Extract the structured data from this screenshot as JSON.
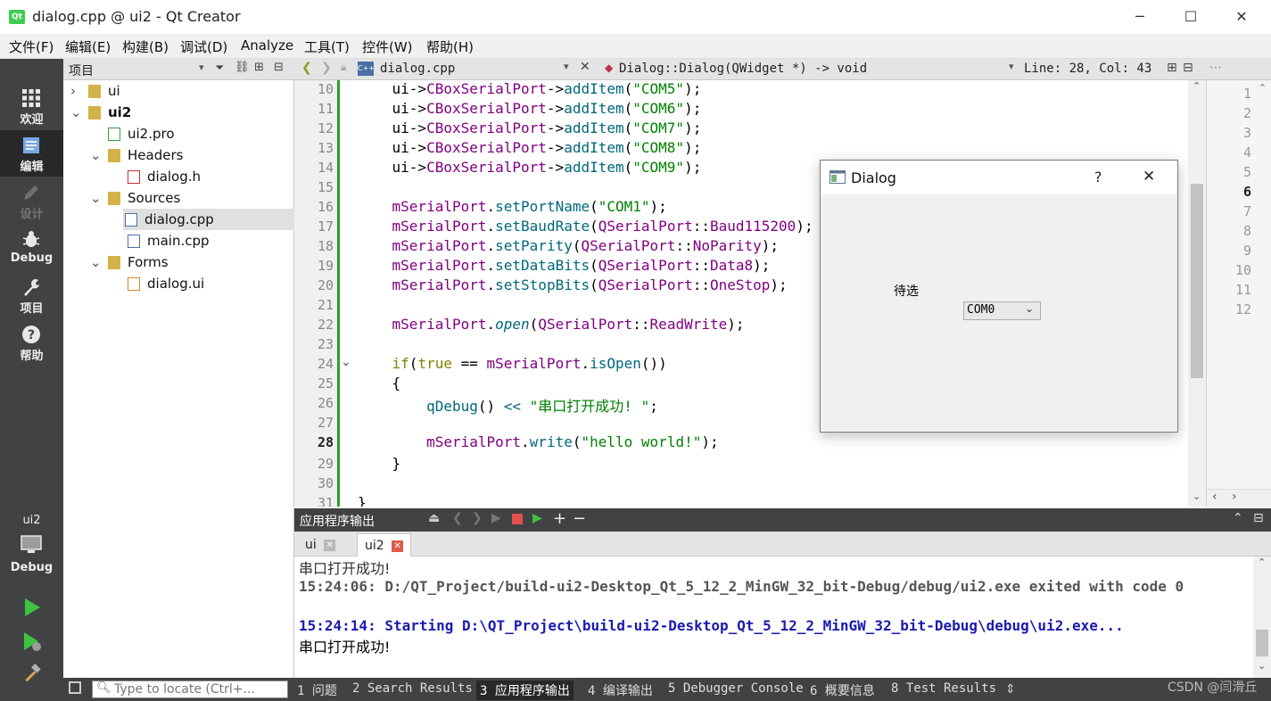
{
  "window": {
    "title": "dialog.cpp @ ui2 - Qt Creator",
    "logo": "Qt",
    "controls": [
      "─",
      "☐",
      "✕"
    ]
  },
  "menubar": [
    "文件(F)",
    "编辑(E)",
    "构建(B)",
    "调试(D)",
    "Analyze",
    "工具(T)",
    "控件(W)",
    "帮助(H)"
  ],
  "modes": [
    {
      "label": "欢迎",
      "icon": "grid-icon"
    },
    {
      "label": "编辑",
      "icon": "document-icon"
    },
    {
      "label": "设计",
      "icon": "pencil-icon"
    },
    {
      "label": "Debug",
      "icon": "bug-icon"
    },
    {
      "label": "项目",
      "icon": "wrench-icon"
    },
    {
      "label": "帮助",
      "icon": "help-icon"
    }
  ],
  "kit": {
    "project": "ui2",
    "mode": "Debug"
  },
  "project_panel": {
    "title": "项目",
    "tree": [
      {
        "label": "ui",
        "level": 0,
        "arrow": ">",
        "type": "project"
      },
      {
        "label": "ui2",
        "level": 0,
        "arrow": "v",
        "type": "project",
        "bold": true
      },
      {
        "label": "ui2.pro",
        "level": 1,
        "arrow": "",
        "type": "pro"
      },
      {
        "label": "Headers",
        "level": 1,
        "arrow": "v",
        "type": "folder-h"
      },
      {
        "label": "dialog.h",
        "level": 2,
        "arrow": "",
        "type": "header"
      },
      {
        "label": "Sources",
        "level": 1,
        "arrow": "v",
        "type": "folder-c"
      },
      {
        "label": "dialog.cpp",
        "level": 2,
        "arrow": "",
        "type": "cpp",
        "selected": true
      },
      {
        "label": "main.cpp",
        "level": 2,
        "arrow": "",
        "type": "cpp"
      },
      {
        "label": "Forms",
        "level": 1,
        "arrow": "v",
        "type": "folder-f"
      },
      {
        "label": "dialog.ui",
        "level": 2,
        "arrow": "",
        "type": "ui"
      }
    ]
  },
  "editor": {
    "file": "dialog.cpp",
    "symbol": "Dialog::Dialog(QWidget *) -> void",
    "position": "Line: 28, Col: 43",
    "current_line": 28,
    "lines": [
      {
        "n": 10,
        "html": "    ui-><span class=\"enm\">CBoxSerialPort</span>-><span class=\"fn\">addItem</span>(<span class=\"str\">\"COM5\"</span>);"
      },
      {
        "n": 11,
        "html": "    ui-><span class=\"enm\">CBoxSerialPort</span>-><span class=\"fn\">addItem</span>(<span class=\"str\">\"COM6\"</span>);"
      },
      {
        "n": 12,
        "html": "    ui-><span class=\"enm\">CBoxSerialPort</span>-><span class=\"fn\">addItem</span>(<span class=\"str\">\"COM7\"</span>);"
      },
      {
        "n": 13,
        "html": "    ui-><span class=\"enm\">CBoxSerialPort</span>-><span class=\"fn\">addItem</span>(<span class=\"str\">\"COM8\"</span>);"
      },
      {
        "n": 14,
        "html": "    ui-><span class=\"enm\">CBoxSerialPort</span>-><span class=\"fn\">addItem</span>(<span class=\"str\">\"COM9\"</span>);"
      },
      {
        "n": 15,
        "html": ""
      },
      {
        "n": 16,
        "html": "    <span class=\"enm\">mSerialPort</span>.<span class=\"fn\">setPortName</span>(<span class=\"str\">\"COM1\"</span>);"
      },
      {
        "n": 17,
        "html": "    <span class=\"enm\">mSerialPort</span>.<span class=\"fn\">setBaudRate</span>(<span class=\"enm\">QSerialPort</span>::<span class=\"enm\">Baud115200</span>);"
      },
      {
        "n": 18,
        "html": "    <span class=\"enm\">mSerialPort</span>.<span class=\"fn\">setParity</span>(<span class=\"enm\">QSerialPort</span>::<span class=\"enm\">NoParity</span>);"
      },
      {
        "n": 19,
        "html": "    <span class=\"enm\">mSerialPort</span>.<span class=\"fn\">setDataBits</span>(<span class=\"enm\">QSerialPort</span>::<span class=\"enm\">Data8</span>);"
      },
      {
        "n": 20,
        "html": "    <span class=\"enm\">mSerialPort</span>.<span class=\"fn\">setStopBits</span>(<span class=\"enm\">QSerialPort</span>::<span class=\"enm\">OneStop</span>);"
      },
      {
        "n": 21,
        "html": ""
      },
      {
        "n": 22,
        "html": "    <span class=\"enm\">mSerialPort</span>.<span class=\"fn it\">open</span>(<span class=\"enm\">QSerialPort</span>::<span class=\"enm\">ReadWrite</span>);"
      },
      {
        "n": 23,
        "html": ""
      },
      {
        "n": 24,
        "html": "    <span class=\"kw\">if</span>(<span class=\"kw\">true</span> == <span class=\"enm\">mSerialPort</span>.<span class=\"fn\">isOpen</span>())"
      },
      {
        "n": 25,
        "html": "    {"
      },
      {
        "n": 26,
        "html": "        <span class=\"fn\">qDebug</span>() <span class=\"fn\">&lt;&lt;</span> <span class=\"str\">\"串口打开成功! \"</span>;"
      },
      {
        "n": 27,
        "html": ""
      },
      {
        "n": 28,
        "html": "        <span class=\"enm\">mSerialPort</span>.<span class=\"fn\">write</span>(<span class=\"str\">\"hello world!\"</span>);"
      },
      {
        "n": 29,
        "html": "    }"
      },
      {
        "n": 30,
        "html": ""
      },
      {
        "n": 31,
        "html": "}"
      }
    ],
    "minimap_lines": [
      "1",
      "2",
      "3",
      "4",
      "5",
      "6",
      "7",
      "8",
      "9",
      "10",
      "11",
      "12"
    ]
  },
  "dialog": {
    "title": "Dialog",
    "help": "?",
    "close": "✕",
    "label": "待选",
    "combo_value": "COM0"
  },
  "output": {
    "title": "应用程序输出",
    "tabs": [
      {
        "label": "ui",
        "active": false
      },
      {
        "label": "ui2",
        "active": true
      }
    ],
    "lines": [
      {
        "text": "串口打开成功!",
        "style": "faded"
      },
      {
        "text": "15:24:06: D:/QT_Project/build-ui2-Desktop_Qt_5_12_2_MinGW_32_bit-Debug/debug/ui2.exe exited with code 0",
        "style": "gray-bold"
      },
      {
        "text": "",
        "style": "blank"
      },
      {
        "text": "15:24:14: Starting D:\\QT_Project\\build-ui2-Desktop_Qt_5_12_2_MinGW_32_bit-Debug\\debug\\ui2.exe...",
        "style": "blue-bold"
      },
      {
        "text": "串口打开成功!",
        "style": "normal"
      }
    ]
  },
  "statusbar": {
    "locate_placeholder": "Type to locate (Ctrl+...",
    "panes": [
      "1 问题",
      "2 Search Results",
      "3 应用程序输出",
      "4 编译输出",
      "5 Debugger Console",
      "6 概要信息",
      "8 Test Results"
    ],
    "active_pane": 2,
    "watermark": "CSDN @闫滑丘"
  },
  "colors": {
    "accent_green": "#41cd52",
    "mode_bar": "#404244",
    "keyword": "#808000",
    "function": "#00677c",
    "string": "#008000",
    "member": "#800080",
    "output_blue": "#1a1ab0",
    "output_gray": "#555555"
  }
}
